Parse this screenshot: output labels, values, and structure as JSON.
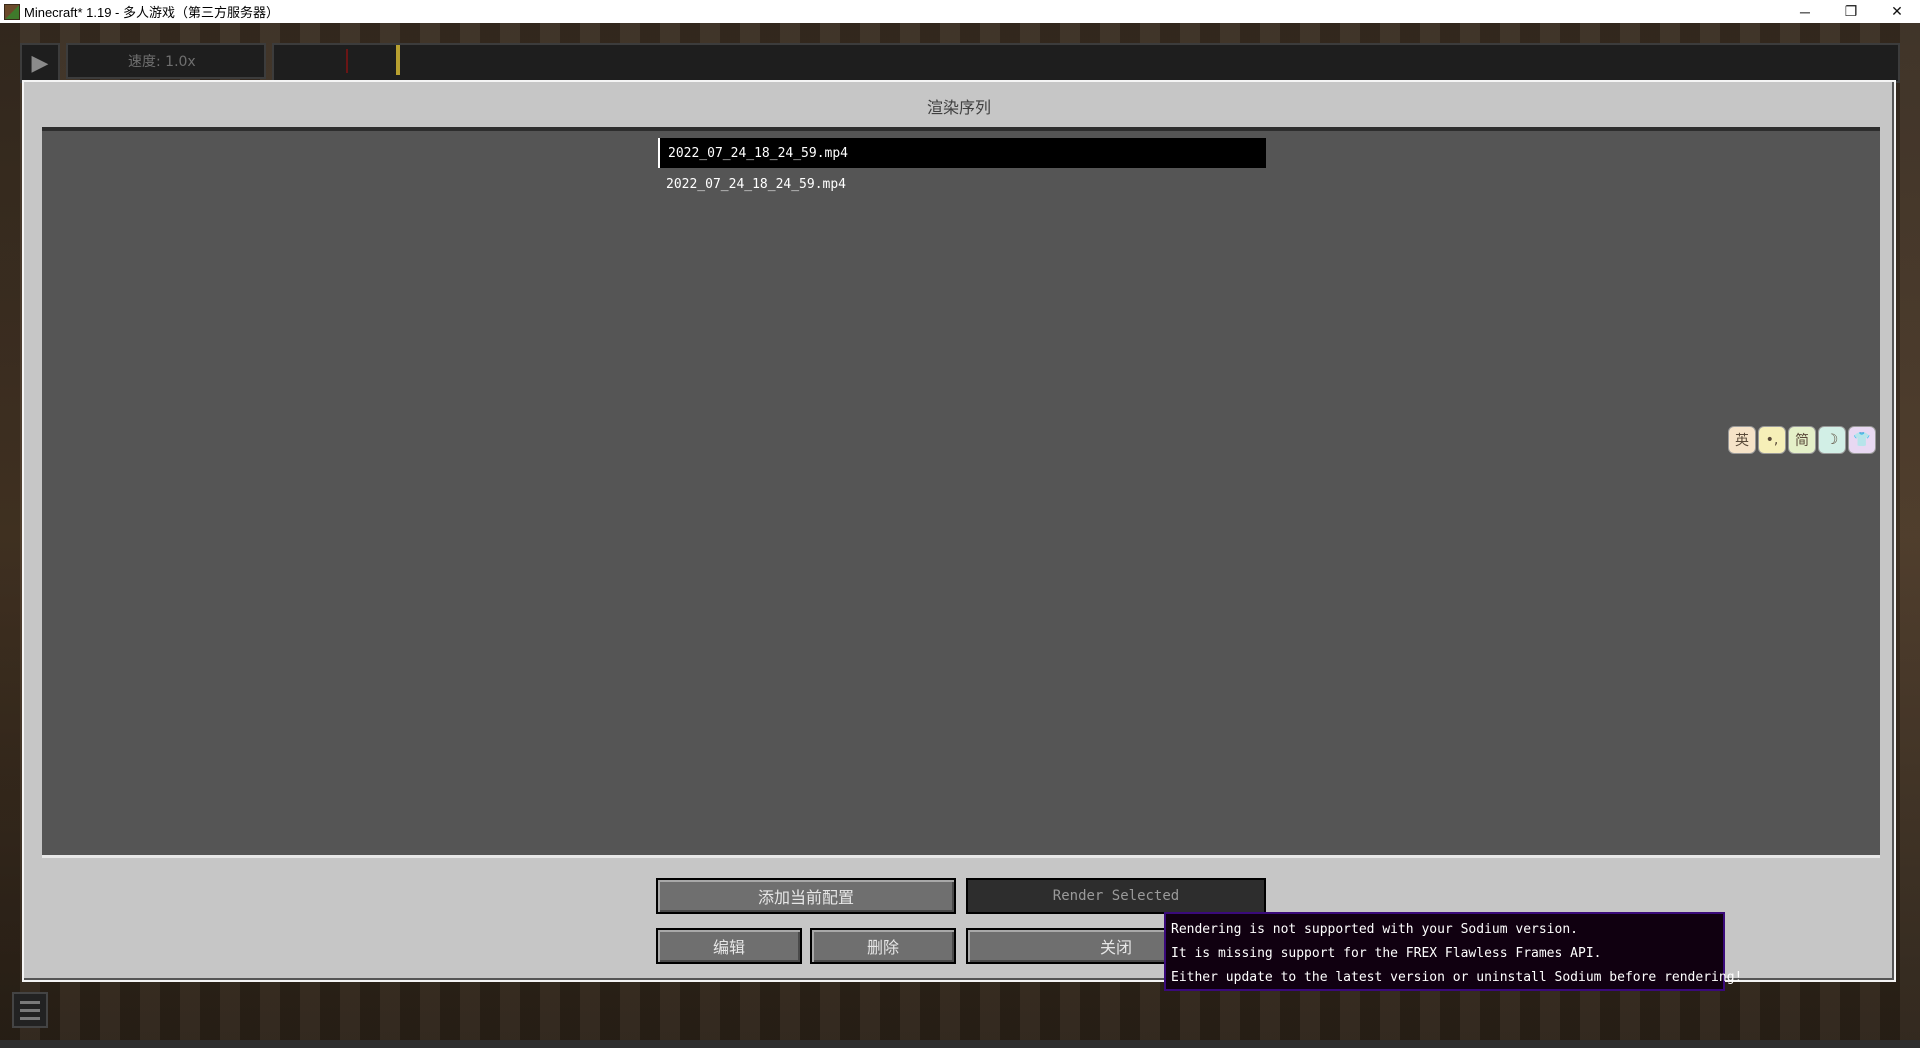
{
  "window": {
    "title": "Minecraft* 1.19 - 多人游戏（第三方服务器）",
    "minimize": "─",
    "restore": "❐",
    "close": "✕"
  },
  "replay_bar": {
    "play_icon": "▶",
    "speed_label": "速度: 1.0x"
  },
  "dialog": {
    "title": "渲染序列",
    "queue": [
      {
        "name": "2022_07_24_18_24_59.mp4",
        "selected": true
      },
      {
        "name": "2022_07_24_18_24_59.mp4",
        "selected": false
      }
    ],
    "buttons": {
      "add_current": "添加当前配置",
      "render_selected": "Render Selected",
      "edit": "编辑",
      "delete": "删除",
      "close": "关闭"
    }
  },
  "ime_toolbar": [
    "英",
    "•,",
    "简",
    "☽",
    "👕"
  ],
  "tooltip": {
    "line1": "Rendering is not supported with your Sodium version.",
    "line2": "It is missing support for the FREX Flawless Frames API.",
    "line3": "Either update to the latest version or uninstall Sodium before rendering!"
  }
}
